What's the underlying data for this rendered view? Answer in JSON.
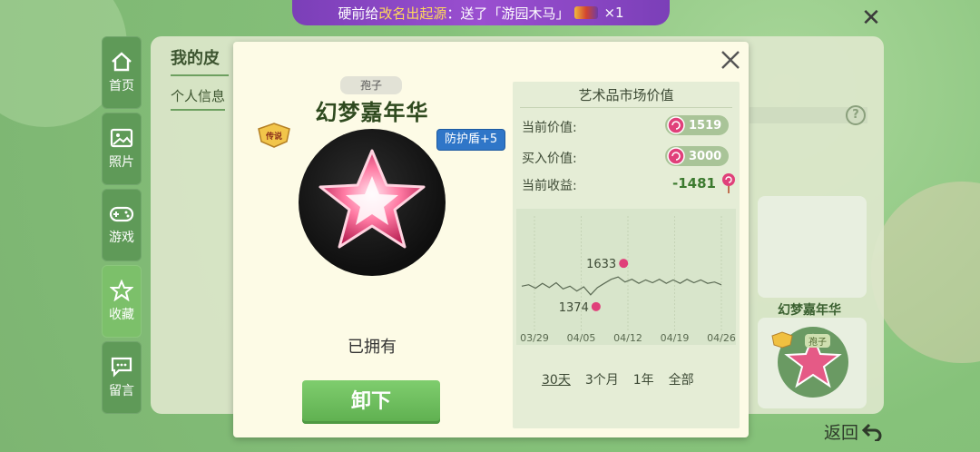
{
  "banner": {
    "prefix": "硬前给",
    "name": "改名出起源",
    "mid": "：送了「",
    "gift": "游园木马",
    "suffix": "」",
    "count": "×1"
  },
  "nav": [
    {
      "label": "首页",
      "icon": "home-icon"
    },
    {
      "label": "照片",
      "icon": "photo-icon"
    },
    {
      "label": "游戏",
      "icon": "gamepad-icon"
    },
    {
      "label": "收藏",
      "icon": "star-icon"
    },
    {
      "label": "留言",
      "icon": "message-icon"
    }
  ],
  "background": {
    "title": "我的皮",
    "subtitle": "个人信息",
    "card_name": "幻梦嘉年华",
    "card_tag": "孢子",
    "back": "返回"
  },
  "item": {
    "type": "孢子",
    "name": "幻梦嘉年华",
    "rarity": "传说",
    "shield": "防护盾+5",
    "status": "已拥有",
    "action": "卸下"
  },
  "market": {
    "title": "艺术品市场价值",
    "current_label": "当前价值:",
    "current_value": "1519",
    "buy_label": "买入价值:",
    "buy_value": "3000",
    "profit_label": "当前收益:",
    "profit_value": "-1481",
    "periods": [
      "30天",
      "3个月",
      "1年",
      "全部"
    ],
    "selected_period": "30天"
  },
  "colors": {
    "accent_green": "#5eaf4f",
    "banner_purple": "#8a46c4",
    "lolly_pink": "#e0407a"
  },
  "chart_data": {
    "type": "line",
    "x_ticks": [
      "03/29",
      "04/05",
      "04/12",
      "04/19",
      "04/26"
    ],
    "annotations": [
      {
        "label": "1633",
        "kind": "max"
      },
      {
        "label": "1374",
        "kind": "min"
      }
    ],
    "values": [
      1500,
      1520,
      1470,
      1540,
      1480,
      1550,
      1460,
      1500,
      1430,
      1490,
      1374,
      1480,
      1540,
      1600,
      1633,
      1560,
      1600,
      1540,
      1590,
      1550,
      1600,
      1540,
      1590,
      1540,
      1600,
      1550,
      1590,
      1540,
      1560,
      1519
    ]
  }
}
